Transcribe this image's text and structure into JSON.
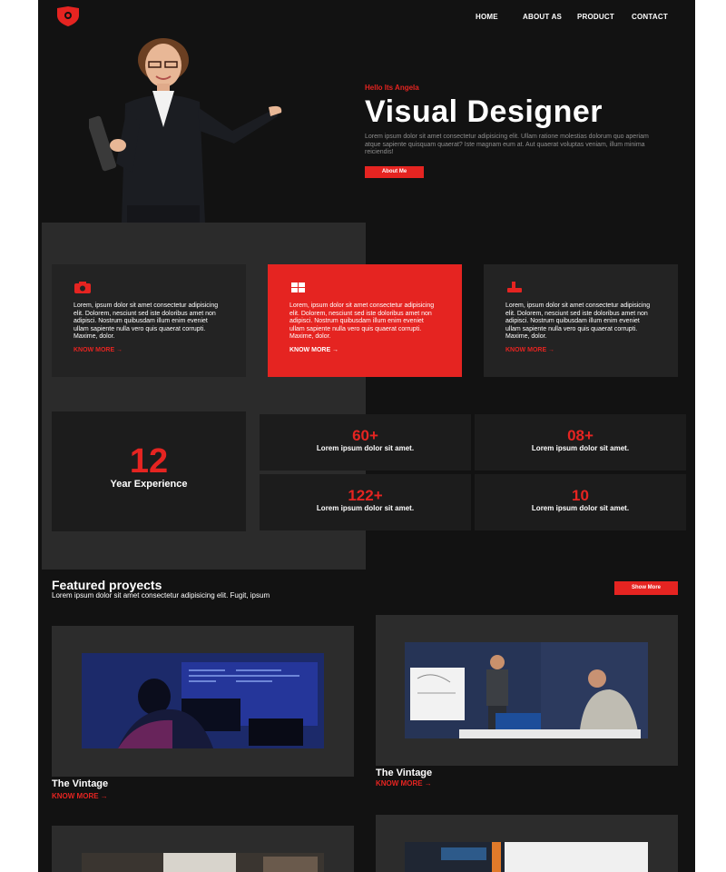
{
  "nav": {
    "logo": "shield-logo",
    "items": [
      {
        "label": "HOME"
      },
      {
        "label": "ABOUT AS"
      },
      {
        "label": "PRODUCT"
      },
      {
        "label": "CONTACT"
      }
    ]
  },
  "hero": {
    "kicker": "Hello Its Angela",
    "title": "Visual Designer",
    "description": "Lorem ipsum dolor sit amet consectetur adipisicing elit. Ullam ratione molestias dolorum quo aperiam atque sapiente quisquam quaerat? Iste magnam eum at. Aut quaerat voluptas veniam, illum minima reiciendis!",
    "button_label": "About Me"
  },
  "services": [
    {
      "icon": "camera-icon",
      "text": "Lorem, ipsum dolor sit amet consectetur adipisicing elit. Dolorem, nesciunt sed iste doloribus amet non adipisci. Nostrum quibusdam illum enim eveniet ullam sapiente nulla vero quis quaerat corrupti. Maxime, dolor.",
      "link": "KNOW MORE"
    },
    {
      "icon": "window-icon",
      "text": "Lorem, ipsum dolor sit amet consectetur adipisicing elit. Dolorem, nesciunt sed iste doloribus amet non adipisci. Nostrum quibusdam illum enim eveniet ullam sapiente nulla vero quis quaerat corrupti. Maxime, dolor.",
      "link": "KNOW MORE"
    },
    {
      "icon": "stamp-icon",
      "text": "Lorem, ipsum dolor sit amet consectetur adipisicing elit. Dolorem, nesciunt sed iste doloribus amet non adipisci. Nostrum quibusdam illum enim eveniet ullam sapiente nulla vero quis quaerat corrupti. Maxime, dolor.",
      "link": "KNOW MORE"
    }
  ],
  "experience": {
    "number": "12",
    "label": "Year Experience"
  },
  "stats": [
    {
      "value": "60+",
      "label": "Lorem ipsum dolor sit amet."
    },
    {
      "value": "08+",
      "label": "Lorem ipsum dolor sit amet."
    },
    {
      "value": "122+",
      "label": "Lorem ipsum dolor sit amet."
    },
    {
      "value": "10",
      "label": "Lorem ipsum dolor sit amet."
    }
  ],
  "featured": {
    "title": "Featured proyects",
    "subtitle": "Lorem ipsum dolor sit amet consectetur adipisicing elit. Fugit, ipsum",
    "button_label": "Show More",
    "projects": [
      {
        "name": "The Vintage",
        "link": "KNOW MORE"
      },
      {
        "name": "The Vintage",
        "link": "KNOW MORE"
      }
    ]
  },
  "colors": {
    "accent": "#e52421",
    "background": "#121212",
    "card": "#232323"
  }
}
